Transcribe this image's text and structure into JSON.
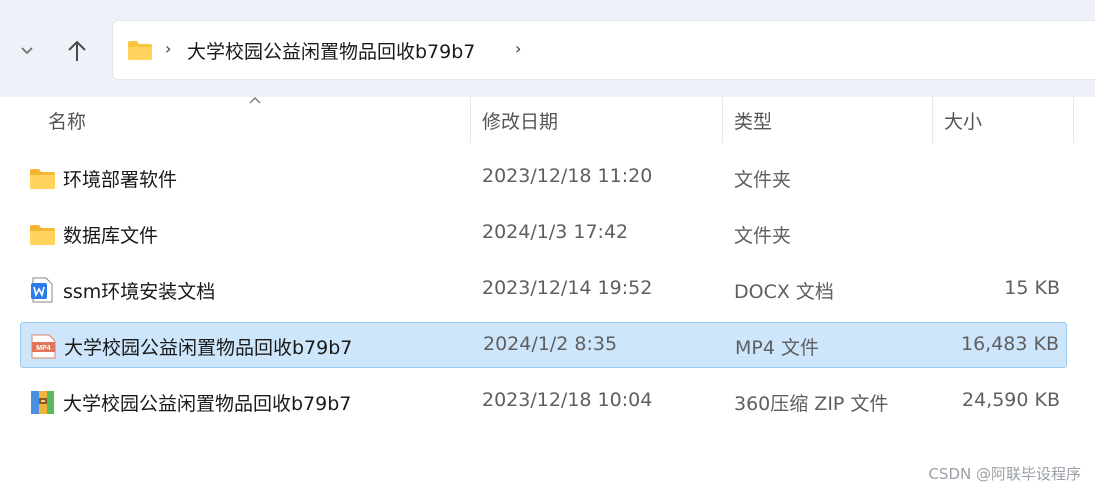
{
  "address_bar": {
    "breadcrumb": "大学校园公益闲置物品回收b79b7",
    "separator": "›"
  },
  "columns": {
    "name": "名称",
    "modified": "修改日期",
    "type": "类型",
    "size": "大小"
  },
  "files": [
    {
      "name": "环境部署软件",
      "modified": "2023/12/18 11:20",
      "type": "文件夹",
      "size": "",
      "icon": "folder-icon"
    },
    {
      "name": "数据库文件",
      "modified": "2024/1/3 17:42",
      "type": "文件夹",
      "size": "",
      "icon": "folder-icon"
    },
    {
      "name": "ssm环境安装文档",
      "modified": "2023/12/14 19:52",
      "type": "DOCX 文档",
      "size": "15 KB",
      "icon": "docx-icon"
    },
    {
      "name": "大学校园公益闲置物品回收b79b7",
      "modified": "2024/1/2 8:35",
      "type": "MP4 文件",
      "size": "16,483 KB",
      "icon": "mp4-icon",
      "selected": true
    },
    {
      "name": "大学校园公益闲置物品回收b79b7",
      "modified": "2023/12/18 10:04",
      "type": "360压缩 ZIP 文件",
      "size": "24,590 KB",
      "icon": "zip-icon"
    }
  ],
  "mp4_badge": "MP4",
  "watermark": "CSDN @阿联毕设程序",
  "colors": {
    "toolbar_bg": "#eef2f8",
    "selection_bg": "#cde6fb",
    "selection_border": "#99cbf1",
    "folder_yellow": "#f9c440"
  }
}
